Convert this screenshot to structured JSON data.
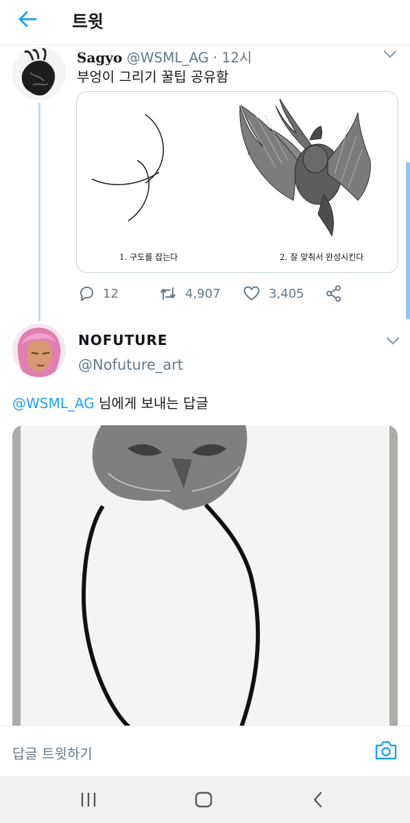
{
  "header": {
    "title": "트윗",
    "back_icon": "arrow-left-icon",
    "accent": "#1da1f2"
  },
  "tweet1": {
    "name": "Sagyo",
    "handle": "@WSML_AG",
    "separator": "·",
    "time": "12시",
    "text": "부엉이 그리기 꿀팁 공유함",
    "image": {
      "caption1": "1. 구도를 잡는다",
      "caption2": "2. 잘 맞춰서 완성시킨다"
    },
    "actions": {
      "replies": "12",
      "retweets": "4,907",
      "likes": "3,405"
    }
  },
  "tweet2": {
    "name": "NOFUTURE",
    "handle": "@Nofuture_art",
    "reply_mention": "@WSML_AG",
    "reply_text": " 님에게 보내는 답글"
  },
  "replybar": {
    "placeholder": "답글 트윗하기"
  },
  "navbar": {
    "recent_icon": "recent-apps-icon",
    "home_icon": "home-icon",
    "back_icon": "back-icon"
  }
}
